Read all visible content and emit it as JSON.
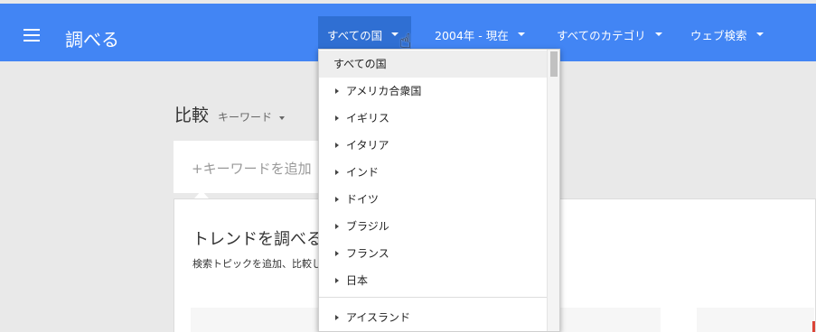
{
  "header": {
    "app_title": "調べる",
    "menu_icon": "hamburger-menu-icon",
    "background_color": "#4285f4",
    "filters": [
      {
        "label": "すべての国"
      },
      {
        "label": "2004年 - 現在"
      },
      {
        "label": "すべてのカテゴリ"
      },
      {
        "label": "ウェブ検索"
      }
    ]
  },
  "compare": {
    "label": "比較",
    "keyword_type": "キーワード",
    "add_keyword_placeholder": "+キーワードを追加"
  },
  "trend_card": {
    "title": "トレンドを調べる",
    "description": "検索トピックを追加、比較し"
  },
  "country_dropdown": {
    "items": [
      {
        "label": "すべての国",
        "selected": true,
        "expandable": false
      },
      {
        "label": "アメリカ合衆国",
        "selected": false,
        "expandable": true
      },
      {
        "label": "イギリス",
        "selected": false,
        "expandable": true
      },
      {
        "label": "イタリア",
        "selected": false,
        "expandable": true
      },
      {
        "label": "インド",
        "selected": false,
        "expandable": true
      },
      {
        "label": "ドイツ",
        "selected": false,
        "expandable": true
      },
      {
        "label": "ブラジル",
        "selected": false,
        "expandable": true
      },
      {
        "label": "フランス",
        "selected": false,
        "expandable": true
      },
      {
        "label": "日本",
        "selected": false,
        "expandable": true
      },
      {
        "label": "アイスランド",
        "selected": false,
        "expandable": true
      }
    ]
  }
}
